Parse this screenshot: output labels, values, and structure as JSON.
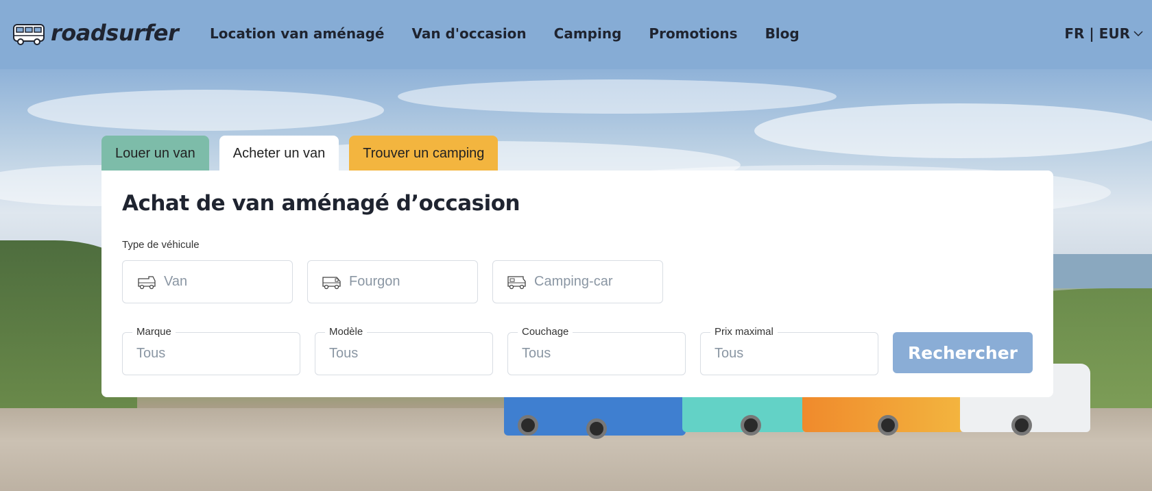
{
  "brand": {
    "name": "roadsurfer"
  },
  "nav": {
    "items": [
      {
        "label": "Location van aménagé"
      },
      {
        "label": "Van d'occasion"
      },
      {
        "label": "Camping"
      },
      {
        "label": "Promotions"
      },
      {
        "label": "Blog"
      }
    ]
  },
  "locale": {
    "label": "FR | EUR"
  },
  "tabs": [
    {
      "label": "Louer un van",
      "color": "#7dbca9"
    },
    {
      "label": "Acheter un van",
      "color": "#ffffff",
      "active": true
    },
    {
      "label": "Trouver un camping",
      "color": "#f3b53f"
    }
  ],
  "card": {
    "title": "Achat de van aménagé d’occasion",
    "vehicle_type_label": "Type de véhicule",
    "vehicle_types": [
      {
        "label": "Van",
        "icon": "van-icon"
      },
      {
        "label": "Fourgon",
        "icon": "fourgon-icon"
      },
      {
        "label": "Camping-car",
        "icon": "camping-car-icon"
      }
    ],
    "filters": [
      {
        "label": "Marque",
        "value": "Tous"
      },
      {
        "label": "Modèle",
        "value": "Tous"
      },
      {
        "label": "Couchage",
        "value": "Tous"
      },
      {
        "label": "Prix maximal",
        "value": "Tous"
      }
    ],
    "search_label": "Rechercher"
  },
  "colors": {
    "header_bg": "#86acd5",
    "search_button": "#8aadd6",
    "text_dark": "#1f2430",
    "placeholder": "#8a96a3"
  }
}
